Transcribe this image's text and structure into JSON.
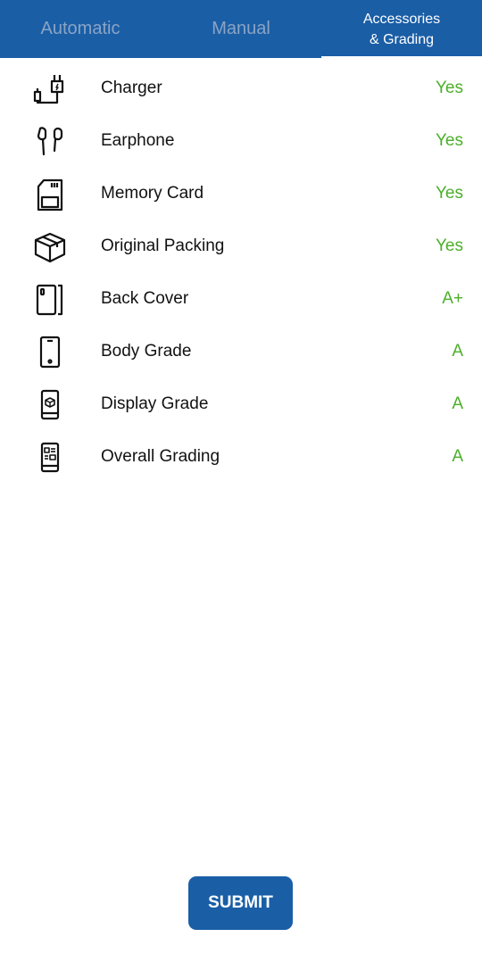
{
  "tabs": [
    {
      "label": "Automatic",
      "active": false
    },
    {
      "label": "Manual",
      "active": false
    },
    {
      "label": "Accessories\n& Grading",
      "active": true
    }
  ],
  "items": [
    {
      "icon": "charger-icon",
      "label": "Charger",
      "value": "Yes"
    },
    {
      "icon": "earphone-icon",
      "label": "Earphone",
      "value": "Yes"
    },
    {
      "icon": "memory-card-icon",
      "label": "Memory Card",
      "value": "Yes"
    },
    {
      "icon": "box-icon",
      "label": "Original Packing",
      "value": "Yes"
    },
    {
      "icon": "back-cover-icon",
      "label": "Back Cover",
      "value": "A+"
    },
    {
      "icon": "phone-body-icon",
      "label": "Body Grade",
      "value": "A"
    },
    {
      "icon": "phone-display-icon",
      "label": "Display Grade",
      "value": "A"
    },
    {
      "icon": "phone-grid-icon",
      "label": "Overall Grading",
      "value": "A"
    }
  ],
  "submit_label": "SUBMIT",
  "colors": {
    "primary": "#1a5ea6",
    "value_green": "#4caf2a"
  }
}
